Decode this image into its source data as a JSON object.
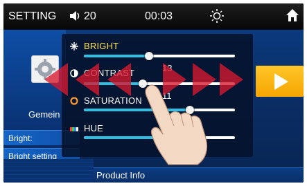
{
  "status_bar": {
    "title": "SETTING",
    "volume": "20",
    "clock": "00:03",
    "icons": [
      "volume-icon",
      "brightness-sun-icon",
      "home-icon"
    ]
  },
  "background": {
    "section_label": "Gemein",
    "row_bright": "Bright:",
    "row_bright_setting": "Bright setting",
    "footer": "Product Info"
  },
  "panel": {
    "rows": [
      {
        "label": "BRIGHT",
        "value": "",
        "level": 0.43,
        "label_color": "#ffe35a"
      },
      {
        "label": "CONTRAST",
        "value": "13",
        "level": 0.39,
        "label_color": "#ffffff"
      },
      {
        "label": "SATURATION",
        "value": "11",
        "level": 0.7,
        "label_color": "#ffffff"
      },
      {
        "label": "HUE",
        "value": "16",
        "level": 0.6,
        "label_color": "#ffffff"
      }
    ]
  },
  "colors": {
    "accent": "#2fbfe3",
    "swipe_arrows": "#d8192f",
    "tile": "#f5a500"
  }
}
